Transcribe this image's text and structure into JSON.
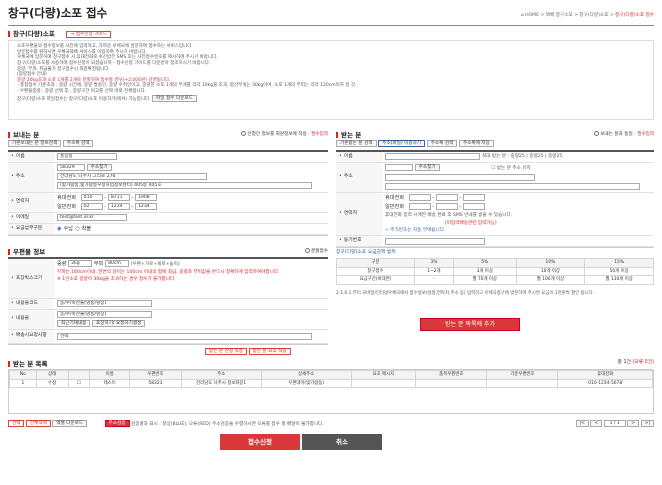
{
  "title": "창구(다량)소포 접수",
  "breadcrumb": [
    "HOME",
    "택배 창구소포",
    "창구(다량)소포",
    "창구(다량)소포 접수"
  ],
  "guide": {
    "heading": "창구(다량)소포",
    "guide_btn": "→ 접수신청 가이드",
    "lines": [
      "소포우편물의 접수정보를 사전에 입력하고, 가까운 우체국에 방문하여 접수하는 서비스입니다.",
      "방문접수를 원하시면 우체국택배 서비스를 이용하여 주시기 바랍니다.",
      "우체국에 방문하여 창구접수 시 휴대전화로 수신받은 SMS 또는 사전접수번호를 제시하여 주시기 바랍니다.",
      "창구(다량)소포를 사용하여 접수신청이 되셨습니까 - 접수신청 가이드를 다운받아 참조하시기 바랍니다.",
      "중량, 부피, 취급불가 창구접수시 최종확정됩니다.",
      "(중량접수 안내)",
      "중량 20kg초과 소포 1개를 2개로 분할하여 접수할 경우(+2,000원) 감면됩니다.",
      "- 총합접수 기준초과 : 중량 시간에, 중량 발송인, 중량 수취인이고, 중량한 소포 1개의 무게를 각각 10kg을 초과, 합산무게는 30kg이며, 소포 1개의 부피는 각각 120cm이하 일 것",
      "· 우편물중량 : 중량 선택 후 , 중량구간 비고를 선택 바로 전체합니다.",
      "창구(다량)소포 파일접수는 창구(다량)소포 이용하기(에서) 가능합니다."
    ],
    "file_btn": "파일 접수 다운로드"
  },
  "sender": {
    "heading": "보내는 분",
    "same_label": "신청인 정보를 회원정보에 적용",
    "req": "필수입력",
    "btn1": "기존보내는 분 정보검색",
    "btn2": "주소록 검색",
    "name_label": "이름",
    "name": "홍길동",
    "addr_label": "주소",
    "zip": "58329",
    "zip_btn": "주소찾기",
    "addr1": "전라남도 나주시 그리로 276",
    "addr2": "(빛가람동,빛가람동우정사업정보센터) 405동 405호",
    "phone_label": "연락처",
    "mobile_label": "휴대전화",
    "m1": "010",
    "m2": "8711",
    "m3": "1908",
    "tel_label": "일반전화",
    "t1": "02",
    "t2": "1234",
    "t3": "1234",
    "email_label": "이메일",
    "email": "test@test.or.kr",
    "smsnoti_label": "요금납부구분",
    "opt1": "수납",
    "opt2": "착불"
  },
  "receiver": {
    "heading": "받는 분",
    "same_label": "보내는 분과 동일",
    "req": "필수입력",
    "btn1": "기존받는 분 검색",
    "btn2": "주소(파일) 이용하기",
    "btn3": "주소록 검색",
    "btn4": "주소록에 저장",
    "name_label": "이름",
    "name_note": "최대 받는 분 : 중량25 | 중량25 | 중량25",
    "addr_label": "주소",
    "zip_btn": "주소찾기",
    "addr_note": "받는 분 주소 유지",
    "phone_label": "연락처",
    "mobile_label": "휴대전화",
    "tel_label": "일반전화",
    "phone_note": "휴대전화 입력 시에만 배송 완료 후 SMS 안내를 받을 수 있습니다.",
    "phone_note2": "[미입력배송관련 입력가능]",
    "extra": "+ 추가번호는 자동 부여됩니다.",
    "memo_label": "동기번호"
  },
  "parcel": {
    "heading": "우편물 정보",
    "opt": "분할접수",
    "size_label": "포장박스크기",
    "w_lbl": "중량",
    "w_val": "2kg",
    "v_lbl": "부피",
    "v_val": "80cm",
    "v_note": "(우편+가로+세로+높이)",
    "size_note": "부피는 160cm이내, 한변의 길이는 100cm 이내의 합에 최금, 중량과 부피값을 반드시 정확하게 입력하여야합니다.",
    "size_note2": "※ 1인소포 중량이 30kg을 초과하는 경우 접수가 불가합니다.",
    "type_label": "내용물코드",
    "type_val": "농/수/축산물(냉동/냉장)",
    "content_label": "내용물",
    "content_val": "농/수/축산물(냉동/냉장)",
    "content_btn1": "최근기재내용",
    "content_btn2": "포장하기/ 요청하기생성",
    "ship_label": "배송시요청사항",
    "ship_val": "선택"
  },
  "fee": {
    "title": "창구(다량)소포 요금감액 범위",
    "cols": [
      "구분",
      "3%",
      "5%",
      "10%",
      "15%"
    ],
    "row_head": "창구접수",
    "rows": [
      [
        "요금구간",
        "1~2개",
        "3개 이상",
        "10개 이상",
        "50개 이상"
      ],
      [
        "요금구간(비대면)",
        "-",
        "월 70개 이상",
        "월 100개 이상",
        "월 130개 이상"
      ]
    ],
    "note": "2.1.6.1.부터 모바일/인터넷우체국에서 접수정보(성명,연락처,주소 등) 입력하고 우체국창구에 방문하여 주시면 요금이 1천원씩 할인 됩니다.",
    "add_btn": "받는 분 목록에 추가"
  },
  "mid_btns": {
    "b1": "받는 분 산정 적용",
    "b2": "받는 분 요후 적용"
  },
  "list": {
    "heading": "받는 분 목록",
    "count": "총 1건",
    "error": "(오류 0건)",
    "headers": [
      "No",
      "상태",
      "",
      "이름",
      "우편번호",
      "주소",
      "상세주소",
      "요호 메시지",
      "품목우편번호",
      "기준우편번호",
      "휴대전화"
    ],
    "rows": [
      [
        "1",
        "수정",
        "",
        "테스트",
        "58323",
        "전라남도 나주시 정보화길1",
        "우편데이(빛가람동)",
        "",
        "",
        "",
        "010-1234-5678"
      ]
    ]
  },
  "footer": {
    "b1": "선택",
    "b2": "전체삭제",
    "b3": "엑셀 다운로드",
    "tag": "주소검증",
    "legend": "검증결과 표시 : 정상(BLUE), 오류(RED)  주소검증을 수행하시면 오류를 접수 할 배달이 불가합니다.",
    "page": "1 / 1"
  },
  "actions": {
    "submit": "접수신청",
    "cancel": "취소"
  }
}
